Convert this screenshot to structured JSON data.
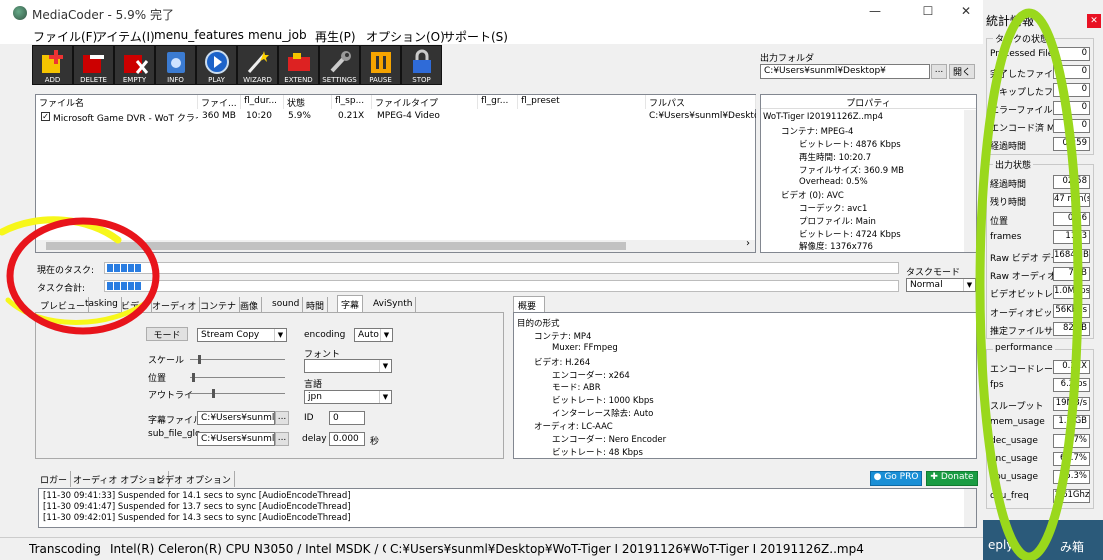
{
  "window": {
    "title": "MediaCoder - 5.9% 完了",
    "minimize": "—",
    "maximize": "☐",
    "close": "✕"
  },
  "menu": [
    "ファイル(F)",
    "アイテム(I)",
    "menu_features",
    "menu_job",
    "再生(P)",
    "オプション(O)",
    "サポート(S)"
  ],
  "toolbar": [
    "ADD",
    "DELETE",
    "EMPTY",
    "INFO",
    "PLAY",
    "WIZARD",
    "EXTEND",
    "SETTINGS",
    "PAUSE",
    "STOP"
  ],
  "output": {
    "label": "出力フォルダ",
    "path": "C:¥Users¥sunml¥Desktop¥",
    "browse": "...",
    "open": "開く"
  },
  "filelist": {
    "headers": [
      "ファイル名",
      "ファイ...",
      "fl_dur...",
      "状態",
      "fl_sp...",
      "ファイルタイプ",
      "fl_gr...",
      "fl_preset",
      "フルパス"
    ],
    "rows": [
      [
        "Microsoft Game DVR - WoT クライア...",
        "360 MB",
        "10:20",
        "5.9%",
        "0.21X",
        "MPEG-4 Video",
        "",
        "",
        "C:¥Users¥sunml¥Desktop¥..."
      ]
    ],
    "scroll_right": "›"
  },
  "properties": {
    "title": "プロパティ",
    "lines": [
      "WoT-Tiger I20191126Z..mp4",
      "コンテナ: MPEG-4",
      "ビットレート: 4876 Kbps",
      "再生時間: 10:20.7",
      "ファイルサイズ: 360.9 MB",
      "Overhead: 0.5%",
      "ビデオ (0): AVC",
      "コーデック: avc1",
      "プロファイル: Main",
      "ビットレート: 4724 Kbps",
      "解像度: 1376x776"
    ]
  },
  "tasks": {
    "current_label": "現在のタスク:",
    "total_label": "タスク合計:",
    "current_progress": 0.059,
    "total_progress": 0.059,
    "mode_label": "タスクモード",
    "mode_value": "Normal"
  },
  "tabs": [
    "プレビュー",
    "tasking",
    "ビデオ",
    "オーディオ",
    "コンテナ",
    "画像",
    "sound",
    "時間",
    "字幕",
    "AviSynth"
  ],
  "subtitle": {
    "mode_btn": "モード",
    "mode_value": "Stream Copy",
    "encoding_label": "encoding",
    "encoding_value": "Auto",
    "scale_label": "スケール",
    "pos_label": "位置",
    "outline_label": "アウトライ",
    "font_label": "フォント",
    "font_value": "",
    "lang_label": "言語",
    "lang_value": "jpn",
    "file_label": "字幕ファイル",
    "file_value": "C:¥Users¥sunml¥D",
    "sub_label": "sub_file_glo",
    "sub_value": "C:¥Users¥sunml¥D",
    "id_label": "ID",
    "id_value": "0",
    "delay_label": "delay",
    "delay_value": "0.000",
    "delay_unit": "秒",
    "dots": "..."
  },
  "summary": {
    "tab": "概要",
    "lines": [
      "目的の形式",
      "コンテナ: MP4",
      "Muxer: FFmpeg",
      "ビデオ: H.264",
      "エンコーダー: x264",
      "モード: ABR",
      "ビットレート: 1000 Kbps",
      "インターレース除去: Auto",
      "オーディオ: LC-AAC",
      "エンコーダー: Nero Encoder",
      "ビットレート: 48 Kbps"
    ]
  },
  "logtabs": [
    "ロガー",
    "オーディオ オプション",
    "ビデオ オプション"
  ],
  "gopro": "Go PRO",
  "donate": "Donate",
  "log": [
    "[11-30 09:41:33] Suspended for 14.1 secs to sync [AudioEncodeThread]",
    "[11-30 09:41:47] Suspended for 13.7 secs to sync [AudioEncodeThread]",
    "[11-30 09:42:01] Suspended for 14.3 secs to sync [AudioEncodeThread]"
  ],
  "statusbar": [
    "Transcoding",
    "Intel(R) Celeron(R) CPU N3050  / Intel MSDK / Op",
    "C:¥Users¥sunml¥Desktop¥WoT-Tiger I 20191126¥WoT-Tiger I 20191126Z..mp4"
  ],
  "stats": {
    "title": "統計情報",
    "close": "✕",
    "g1": "タスクの状態",
    "g1items": [
      [
        "Processed Files",
        "0"
      ],
      [
        "完了したファイル",
        "0"
      ],
      [
        "スキップしたファイル",
        "0"
      ],
      [
        "エラーファイル",
        "0"
      ],
      [
        "エンコード済 MBs",
        "0"
      ],
      [
        "経過時間",
        "02:59"
      ]
    ],
    "g2": "出力状態",
    "g2items": [
      [
        "経過時間",
        "02:58"
      ],
      [
        "残り時間",
        "47 min(s)"
      ],
      [
        "位置",
        "0:36"
      ],
      [
        "frames",
        "1103"
      ],
      [
        "Raw ビデオ データ",
        "1684MB"
      ],
      [
        "Raw オーディオ デ",
        "7MB"
      ],
      [
        "ビデオビットレート",
        "1.0Mbps"
      ],
      [
        "オーディオビットレ",
        "56Kbps"
      ],
      [
        "推定ファイルサイ",
        "82MB"
      ]
    ],
    "g3": "performance",
    "g3items": [
      [
        "エンコードレート",
        "0.21X"
      ],
      [
        "fps",
        "6.2fps"
      ],
      [
        "スループット",
        "19MB/s"
      ],
      [
        "mem_usage",
        "1.2 GB"
      ],
      [
        "dec_usage",
        "4.7%"
      ],
      [
        "enc_usage",
        "68.7%"
      ],
      [
        "cpu_usage",
        "95.3%"
      ],
      [
        "cpu_freq",
        "1.61Ghz"
      ]
    ]
  },
  "desktop": {
    "left": "eply",
    "right": "み箱"
  },
  "colors": {
    "annot_red": "#e8141b",
    "annot_yellow": "#f7f71a",
    "annot_green": "#9ad81c",
    "progress": "#2a7de1"
  }
}
